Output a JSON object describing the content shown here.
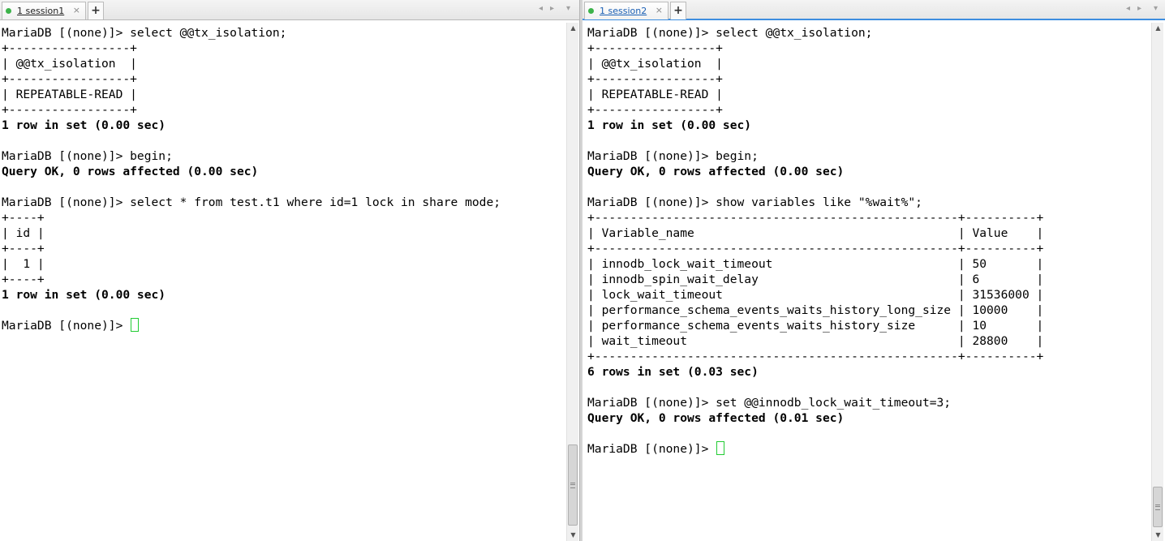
{
  "sessions": [
    {
      "tab_number": "1",
      "tab_name": "session1",
      "active": false,
      "lines": [
        {
          "text": "MariaDB [(none)]> select @@tx_isolation;",
          "bold": false
        },
        {
          "text": "+-----------------+",
          "bold": false
        },
        {
          "text": "| @@tx_isolation  |",
          "bold": false
        },
        {
          "text": "+-----------------+",
          "bold": false
        },
        {
          "text": "| REPEATABLE-READ |",
          "bold": false
        },
        {
          "text": "+-----------------+",
          "bold": false
        },
        {
          "text": "1 row in set (0.00 sec)",
          "bold": true
        },
        {
          "text": "",
          "bold": false
        },
        {
          "text": "MariaDB [(none)]> begin;",
          "bold": false
        },
        {
          "text": "Query OK, 0 rows affected (0.00 sec)",
          "bold": true
        },
        {
          "text": "",
          "bold": false
        },
        {
          "text": "MariaDB [(none)]> select * from test.t1 where id=1 lock in share mode;",
          "bold": false
        },
        {
          "text": "+----+",
          "bold": false
        },
        {
          "text": "| id |",
          "bold": false
        },
        {
          "text": "+----+",
          "bold": false
        },
        {
          "text": "|  1 |",
          "bold": false
        },
        {
          "text": "+----+",
          "bold": false
        },
        {
          "text": "1 row in set (0.00 sec)",
          "bold": true
        },
        {
          "text": "",
          "bold": false
        },
        {
          "text": "MariaDB [(none)]> ",
          "bold": false,
          "cursor": true
        }
      ]
    },
    {
      "tab_number": "1",
      "tab_name": "session2",
      "active": true,
      "lines": [
        {
          "text": "MariaDB [(none)]> select @@tx_isolation;",
          "bold": false
        },
        {
          "text": "+-----------------+",
          "bold": false
        },
        {
          "text": "| @@tx_isolation  |",
          "bold": false
        },
        {
          "text": "+-----------------+",
          "bold": false
        },
        {
          "text": "| REPEATABLE-READ |",
          "bold": false
        },
        {
          "text": "+-----------------+",
          "bold": false
        },
        {
          "text": "1 row in set (0.00 sec)",
          "bold": true
        },
        {
          "text": "",
          "bold": false
        },
        {
          "text": "MariaDB [(none)]> begin;",
          "bold": false
        },
        {
          "text": "Query OK, 0 rows affected (0.00 sec)",
          "bold": true
        },
        {
          "text": "",
          "bold": false
        },
        {
          "text": "MariaDB [(none)]> show variables like \"%wait%\";",
          "bold": false
        },
        {
          "text": "+---------------------------------------------------+----------+",
          "bold": false
        },
        {
          "text": "| Variable_name                                     | Value    |",
          "bold": false
        },
        {
          "text": "+---------------------------------------------------+----------+",
          "bold": false
        },
        {
          "text": "| innodb_lock_wait_timeout                          | 50       |",
          "bold": false
        },
        {
          "text": "| innodb_spin_wait_delay                            | 6        |",
          "bold": false
        },
        {
          "text": "| lock_wait_timeout                                 | 31536000 |",
          "bold": false
        },
        {
          "text": "| performance_schema_events_waits_history_long_size | 10000    |",
          "bold": false
        },
        {
          "text": "| performance_schema_events_waits_history_size      | 10       |",
          "bold": false
        },
        {
          "text": "| wait_timeout                                      | 28800    |",
          "bold": false
        },
        {
          "text": "+---------------------------------------------------+----------+",
          "bold": false
        },
        {
          "text": "6 rows in set (0.03 sec)",
          "bold": true
        },
        {
          "text": "",
          "bold": false
        },
        {
          "text": "MariaDB [(none)]> set @@innodb_lock_wait_timeout=3;",
          "bold": false
        },
        {
          "text": "Query OK, 0 rows affected (0.01 sec)",
          "bold": true
        },
        {
          "text": "",
          "bold": false
        },
        {
          "text": "MariaDB [(none)]> ",
          "bold": false,
          "cursor": true
        }
      ]
    }
  ],
  "icons": {
    "close": "×",
    "add_tab": "+",
    "nav_left": "◂",
    "nav_right": "▸",
    "nav_menu": "▾",
    "scroll_up": "▲",
    "scroll_down": "▼"
  },
  "colors": {
    "status_dot": "#3cb34a",
    "cursor": "#22cc33",
    "active_tab_border": "#3d8ee0"
  }
}
